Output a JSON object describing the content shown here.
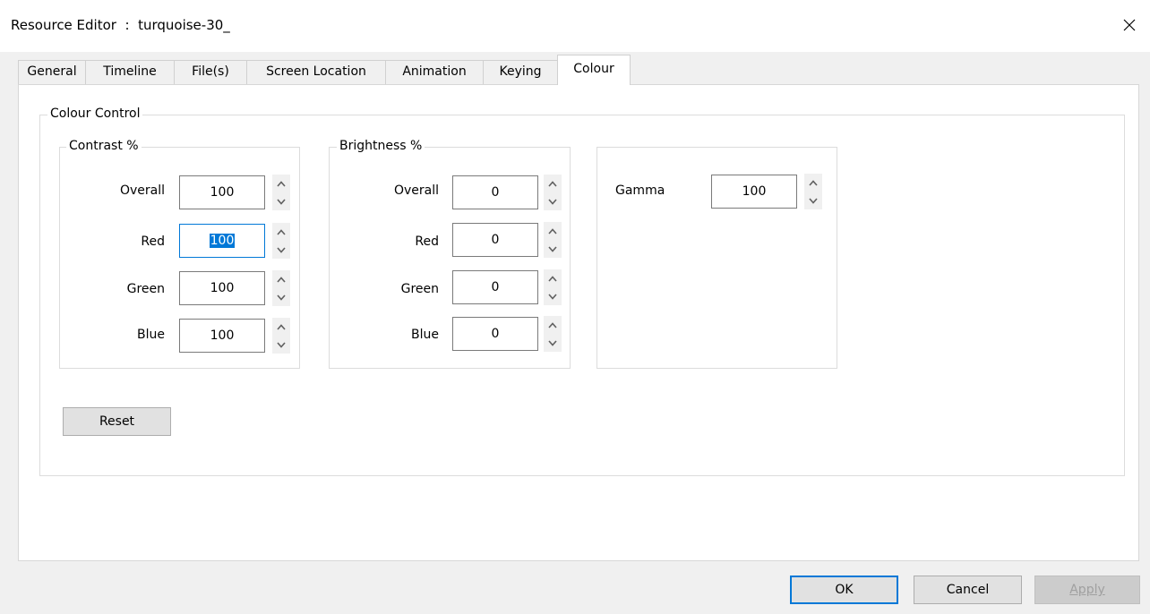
{
  "window": {
    "title": "Resource Editor  :  turquoise-30_",
    "close_glyph": "✕"
  },
  "tabs": [
    {
      "label": "General"
    },
    {
      "label": "Timeline"
    },
    {
      "label": "File(s)"
    },
    {
      "label": "Screen Location"
    },
    {
      "label": "Animation"
    },
    {
      "label": "Keying"
    },
    {
      "label": "Colour",
      "active": true
    }
  ],
  "colour_control": {
    "legend": "Colour Control",
    "contrast": {
      "legend": "Contrast %",
      "overall_label": "Overall",
      "overall_value": "100",
      "red_label": "Red",
      "red_value": "100",
      "green_label": "Green",
      "green_value": "100",
      "blue_label": "Blue",
      "blue_value": "100"
    },
    "brightness": {
      "legend": "Brightness %",
      "overall_label": "Overall",
      "overall_value": "0",
      "red_label": "Red",
      "red_value": "0",
      "green_label": "Green",
      "green_value": "0",
      "blue_label": "Blue",
      "blue_value": "0"
    },
    "gamma": {
      "label": "Gamma",
      "value": "100"
    },
    "reset_label": "Reset"
  },
  "footer": {
    "ok_label": "OK",
    "cancel_label": "Cancel",
    "apply_label": "Apply"
  },
  "colors": {
    "accent": "#0078d7",
    "window_bg": "#f0f0f0",
    "panel_bg": "#ffffff"
  },
  "icons": {
    "close": "close-icon",
    "spin_up": "chevron-up-icon",
    "spin_down": "chevron-down-icon"
  }
}
